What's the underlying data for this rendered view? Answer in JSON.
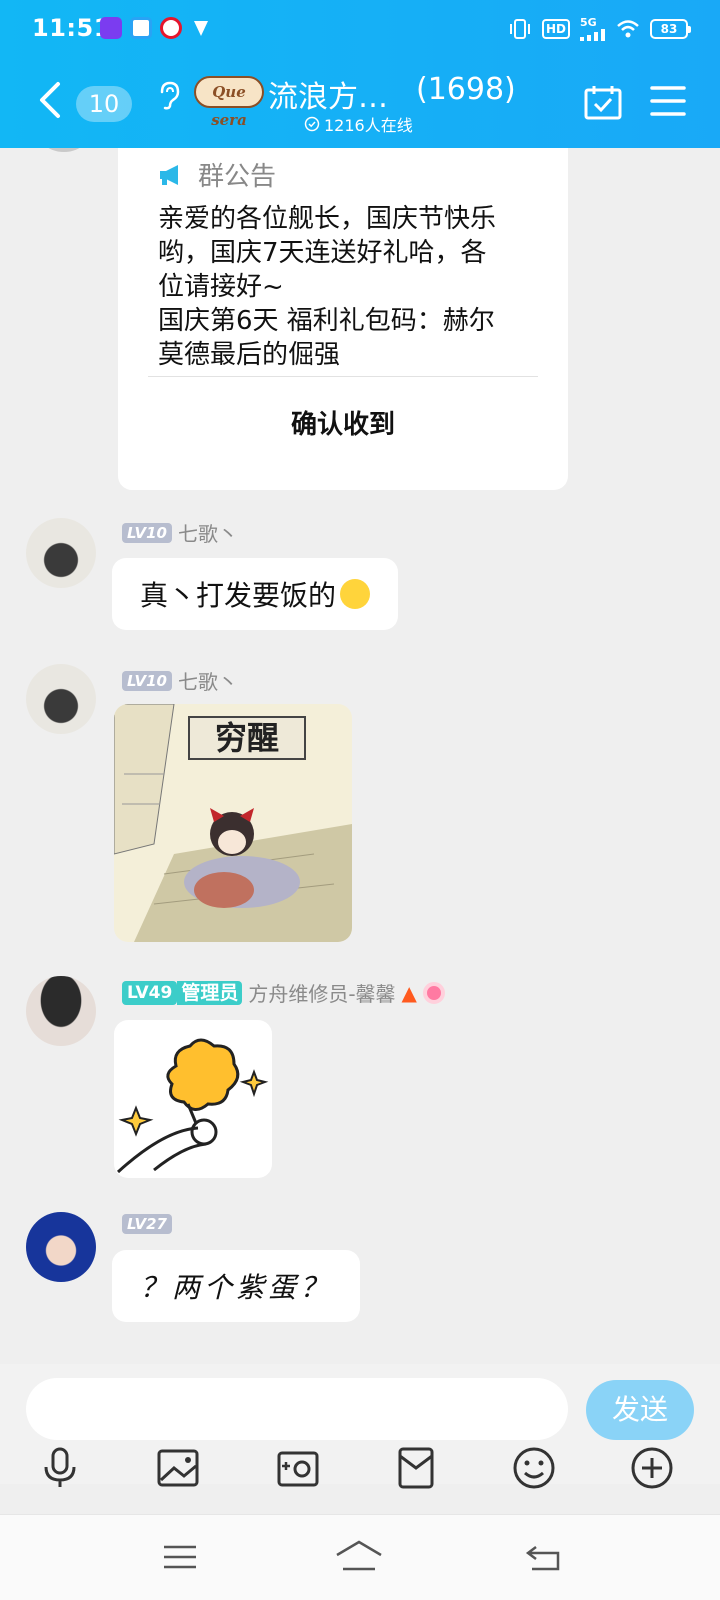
{
  "status_bar": {
    "time": "11:51",
    "network": "5G",
    "hd": "HD",
    "battery": "83"
  },
  "header": {
    "unread_count": "10",
    "group_logo_text": "Que sera",
    "group_title": "流浪方…",
    "member_count": "(1698)",
    "online_text": "1216人在线"
  },
  "announcement": {
    "label": "群公告",
    "lines": [
      "亲爱的各位舰长，国庆节快乐",
      "哟，国庆7天连送好礼哈，各",
      "位请接好~",
      "国庆第6天 福利礼包码：赫尔",
      "莫德最后的倔强"
    ],
    "confirm_label": "确认收到"
  },
  "messages": [
    {
      "level": "LV10",
      "sender": "七歌丶",
      "text": "真丶打发要饭的"
    },
    {
      "level": "LV10",
      "sender": "七歌丶",
      "sticker_text": "穷醒"
    },
    {
      "level": "LV49",
      "role": "管理员",
      "sender": "方舟维修员-馨馨"
    },
    {
      "level": "LV27",
      "sender": "",
      "text": "？两个紫蛋？"
    }
  ],
  "input": {
    "placeholder": "",
    "send_label": "发送"
  },
  "colors": {
    "header_blue": "#12b7f5",
    "send_button": "#8ad3f7",
    "badge_gray": "#b7bdcf",
    "badge_teal": "#3ccdc9"
  },
  "icons": [
    "back-icon",
    "ear-icon",
    "calendar-check-icon",
    "menu-icon",
    "megaphone-icon",
    "mic-icon",
    "image-icon",
    "camera-icon",
    "red-packet-icon",
    "emoji-icon",
    "plus-icon"
  ]
}
